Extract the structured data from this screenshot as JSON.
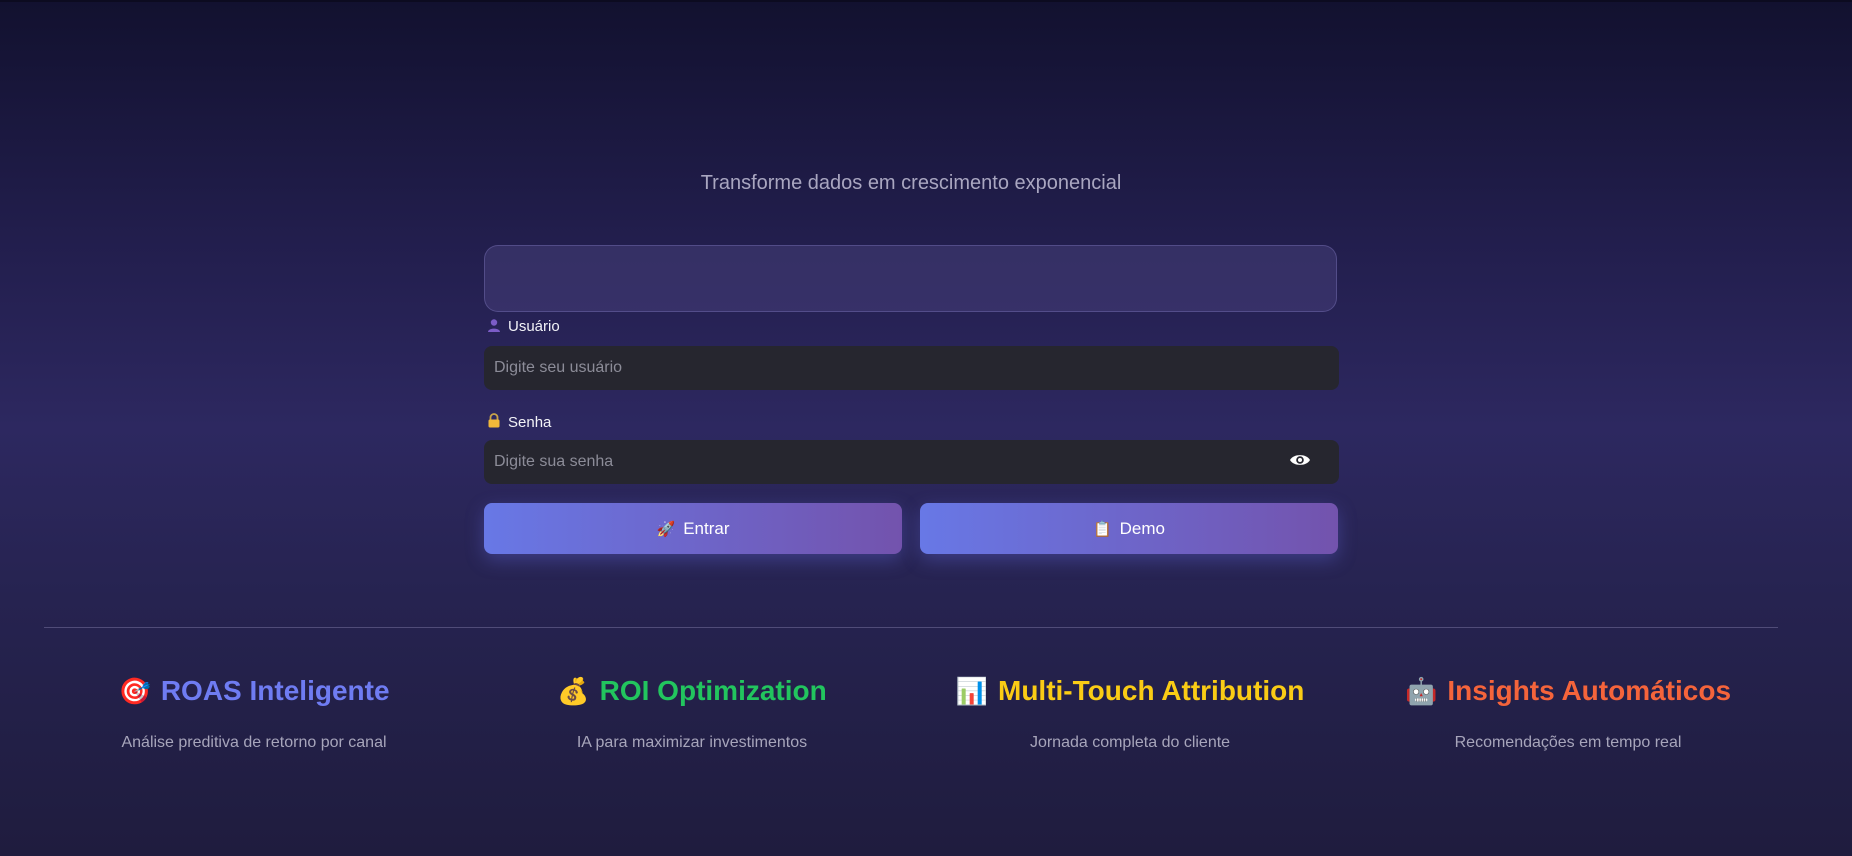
{
  "header": {
    "subtitle": "Transforme dados em crescimento exponencial"
  },
  "login": {
    "username": {
      "icon": "user-icon",
      "label": "Usuário",
      "placeholder": "Digite seu usuário",
      "value": ""
    },
    "password": {
      "icon": "lock-icon",
      "label": "Senha",
      "placeholder": "Digite sua senha",
      "value": "",
      "toggle_icon": "eye-icon"
    },
    "buttons": {
      "enter": {
        "icon": "rocket-icon",
        "label": "Entrar"
      },
      "demo": {
        "icon": "clipboard-icon",
        "label": "Demo"
      }
    }
  },
  "features": [
    {
      "icon": "target-icon",
      "title": "ROAS Inteligente",
      "description": "Análise preditiva de retorno por canal",
      "color": "#6f7cf2"
    },
    {
      "icon": "money-bag-icon",
      "title": "ROI Optimization",
      "description": "IA para maximizar investimentos",
      "color": "#22c55e"
    },
    {
      "icon": "bar-chart-icon",
      "title": "Multi-Touch Attribution",
      "description": "Jornada completa do cliente",
      "color": "#facc15"
    },
    {
      "icon": "robot-icon",
      "title": "Insights Automáticos",
      "description": "Recomendações em tempo real",
      "color": "#f5643b"
    }
  ],
  "colors": {
    "button_gradient_start": "#6878e6",
    "button_gradient_end": "#7353ad",
    "input_background": "#26262f"
  }
}
